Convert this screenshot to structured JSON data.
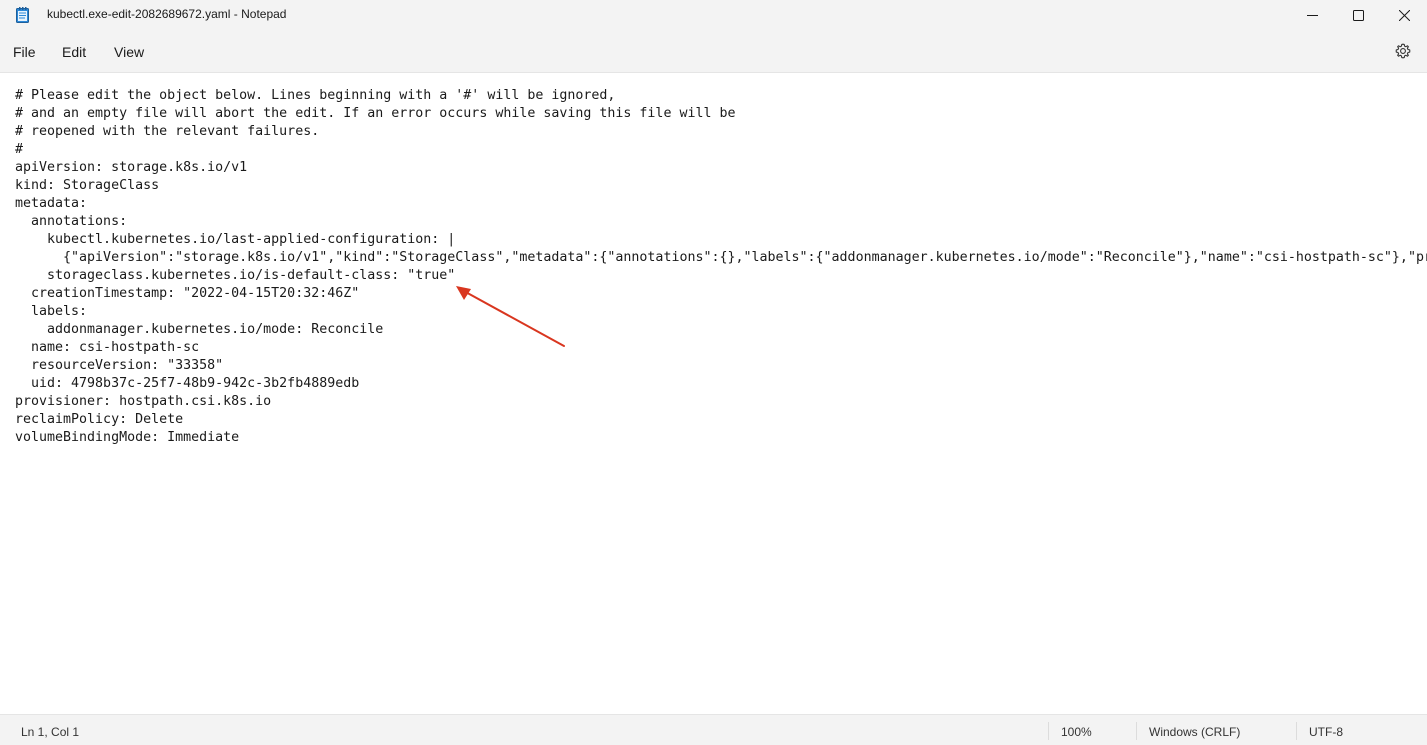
{
  "window": {
    "title": "kubectl.exe-edit-2082689672.yaml - Notepad",
    "icon": "notepad-icon",
    "controls": [
      "minimize-icon",
      "maximize-icon",
      "close-icon"
    ]
  },
  "menu": {
    "file": "File",
    "edit": "Edit",
    "view": "View",
    "settings_icon": "gear-icon"
  },
  "editor": {
    "lines": [
      "# Please edit the object below. Lines beginning with a '#' will be ignored,",
      "# and an empty file will abort the edit. If an error occurs while saving this file will be",
      "# reopened with the relevant failures.",
      "#",
      "apiVersion: storage.k8s.io/v1",
      "kind: StorageClass",
      "metadata:",
      "  annotations:",
      "    kubectl.kubernetes.io/last-applied-configuration: |",
      "      {\"apiVersion\":\"storage.k8s.io/v1\",\"kind\":\"StorageClass\",\"metadata\":{\"annotations\":{},\"labels\":{\"addonmanager.kubernetes.io/mode\":\"Reconcile\"},\"name\":\"csi-hostpath-sc\"},\"pr",
      "    storageclass.kubernetes.io/is-default-class: \"true\"",
      "  creationTimestamp: \"2022-04-15T20:32:46Z\"",
      "  labels:",
      "    addonmanager.kubernetes.io/mode: Reconcile",
      "  name: csi-hostpath-sc",
      "  resourceVersion: \"33358\"",
      "  uid: 4798b37c-25f7-48b9-942c-3b2fb4889edb",
      "provisioner: hostpath.csi.k8s.io",
      "reclaimPolicy: Delete",
      "volumeBindingMode: Immediate"
    ],
    "annotation_arrow_color": "#d9361f"
  },
  "status": {
    "position": "Ln 1, Col 1",
    "zoom": "100%",
    "line_ending": "Windows (CRLF)",
    "encoding": "UTF-8"
  }
}
